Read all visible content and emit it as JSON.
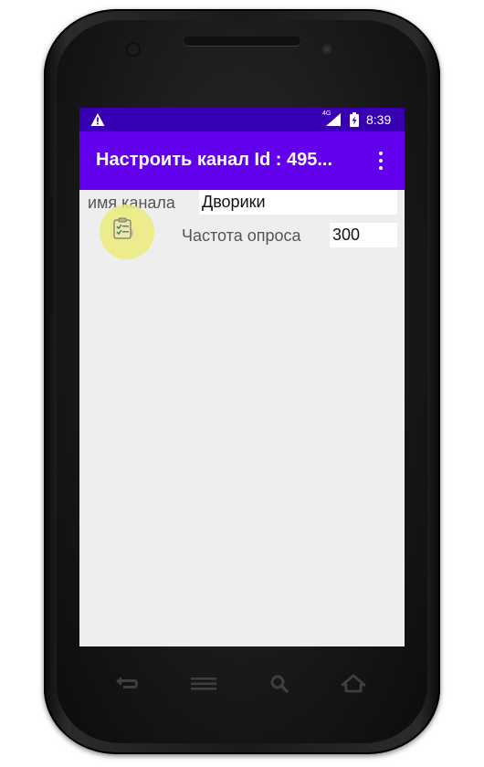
{
  "status_bar": {
    "time": "8:39",
    "network_label": "4G",
    "colors": {
      "background": "#3700b3"
    },
    "icons": [
      "warning-icon",
      "signal-icon",
      "battery-charging-icon"
    ]
  },
  "app_bar": {
    "title": "Настроить канал  Id : 495...",
    "overflow_icon": "more-vert-icon",
    "colors": {
      "background": "#6200ee",
      "text": "#ffffff"
    }
  },
  "form": {
    "channel_name_label": "имя канала",
    "channel_name_value": "Дворики",
    "poll_rate_label": "Частота опроса",
    "poll_rate_value": "300"
  },
  "overlay": {
    "clipboard_icon": "clipboard-check-icon",
    "touch_indicator_color": "#ececa0"
  },
  "nav_bar": {
    "icons": [
      "back-icon",
      "menu-icon",
      "search-icon",
      "home-icon"
    ]
  }
}
